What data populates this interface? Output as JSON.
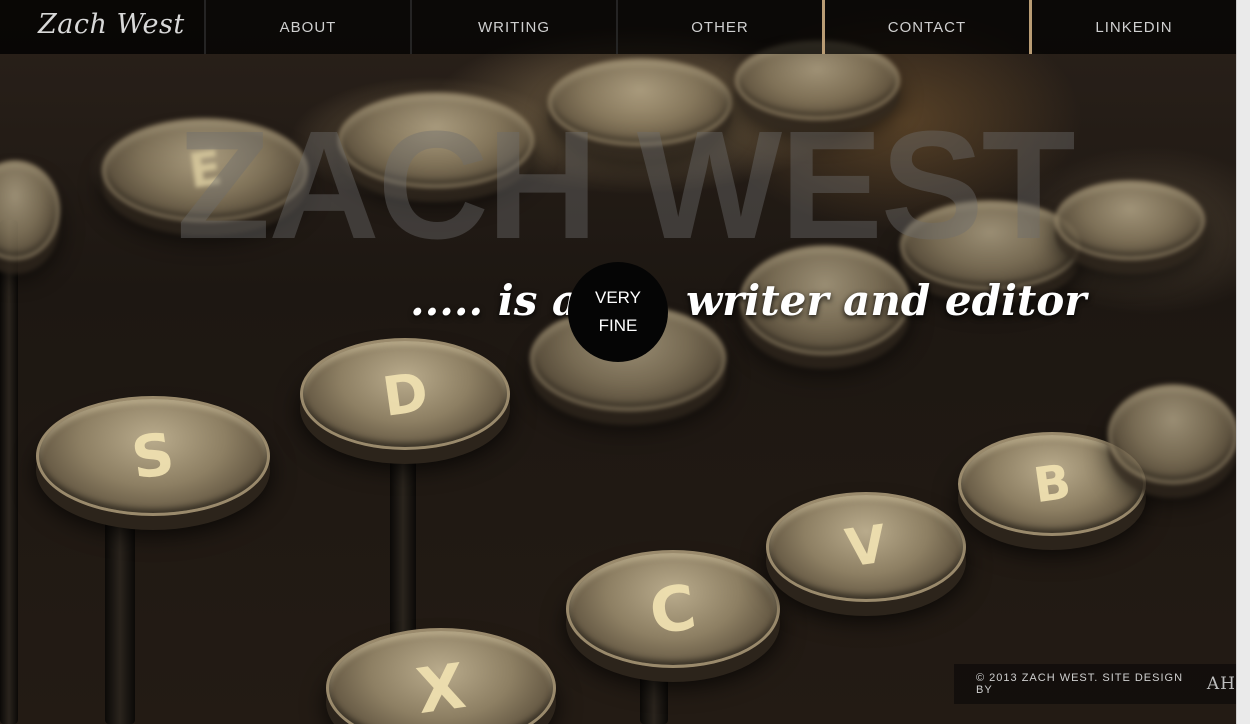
{
  "brand": "Zach West",
  "nav": {
    "items": [
      "ABOUT",
      "WRITING",
      "OTHER",
      "CONTACT",
      "LINKEDIN"
    ]
  },
  "hero": {
    "title": "ZACH WEST",
    "prefix": "..... is a",
    "badge_line1": "VERY",
    "badge_line2": "FINE",
    "suffix": "writer and editor"
  },
  "background_keys": [
    "E",
    "D",
    "S",
    "C",
    "V",
    "B",
    "X"
  ],
  "footer": {
    "credit": "© 2013 ZACH WEST. SITE DESIGN BY",
    "designer_logo": "AH"
  }
}
